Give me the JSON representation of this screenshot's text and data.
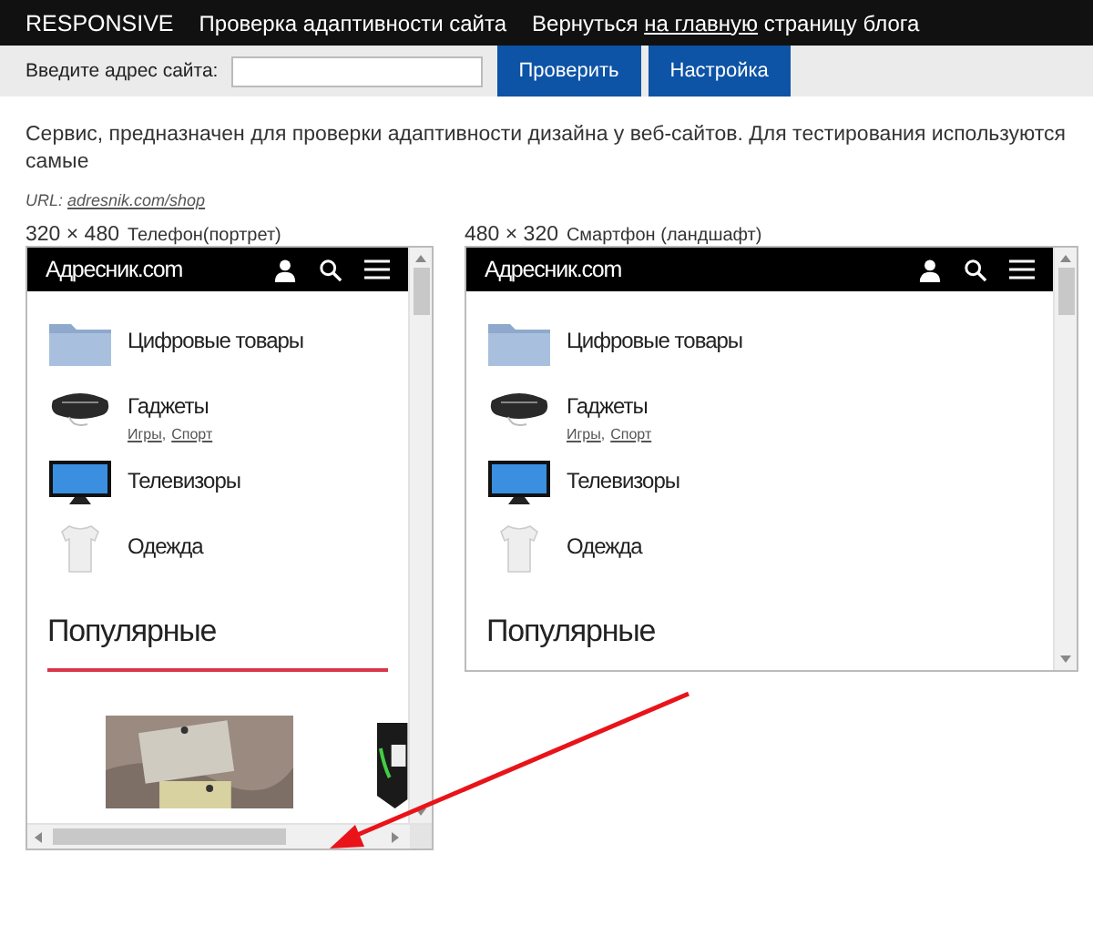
{
  "top_bar": {
    "brand": "RESPONSIVE",
    "title": "Проверка адаптивности сайта",
    "back": {
      "before": "Вернуться",
      "link": "на главную",
      "after": "страницу блога"
    }
  },
  "toolbar": {
    "url_label": "Введите адрес сайта:",
    "buttons": [
      "Проверить",
      "Настройка"
    ]
  },
  "description": "Сервис, предназначен для проверки адаптивности дизайна у веб-сайтов. Для тестирования используются самые",
  "url": {
    "label": "URL:",
    "link": "adresnik.com/shop"
  },
  "previews": [
    {
      "size": "320 × 480",
      "device": "Телефон(портрет)",
      "kind": "portrait",
      "site": {
        "logo": "Адресник.com",
        "menu": [
          {
            "kind": "folder",
            "label": "Цифровые товары"
          },
          {
            "kind": "gadget",
            "label": "Гаджеты",
            "links": [
              "Игры",
              "Спорт"
            ],
            "separator": ","
          },
          {
            "kind": "tv",
            "label": "Телевизоры"
          },
          {
            "kind": "shirt",
            "label": "Одежда"
          }
        ],
        "popular": "Популярные"
      }
    },
    {
      "size": "480 × 320",
      "device": "Смартфон (ландшафт)",
      "kind": "landscape",
      "site": {
        "logo": "Адресник.com",
        "menu": [
          {
            "kind": "folder",
            "label": "Цифровые товары"
          },
          {
            "kind": "gadget",
            "label": "Гаджеты",
            "links": [
              "Игры",
              "Спорт"
            ],
            "separator": ","
          },
          {
            "kind": "tv",
            "label": "Телевизоры"
          },
          {
            "kind": "shirt",
            "label": "Одежда"
          }
        ],
        "popular": "Популярные"
      }
    }
  ]
}
